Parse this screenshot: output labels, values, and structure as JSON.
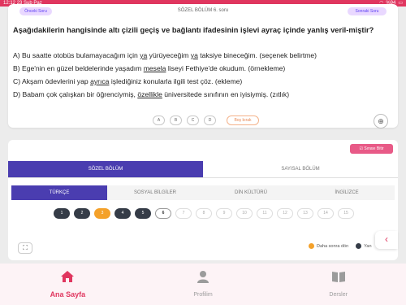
{
  "statusbar": {
    "time": "12:12",
    "date": "23 Şub Paz",
    "battery": "%94"
  },
  "question": {
    "back_label": "Önceki Soru",
    "header_title": "SÖZEL BÖLÜM 6. soru",
    "next_label": "Sonraki Soru",
    "text": "Aşağıdakilerin hangisinde altı çizili geçiş ve bağlantı ifadesinin işlevi ayraç içinde yanlış veril-miştir?",
    "options": [
      {
        "pre": "A) Bu saatte otobüs bulamayacağım için ",
        "u1": "ya",
        "mid": " yürüyeceğim ",
        "u2": "ya",
        "post": " taksiye bineceğim. (seçenek belirtme)"
      },
      {
        "pre": "B) Ege'nin en güzel beldelerinde yaşadım ",
        "u1": "mesela",
        "post": " liseyi Fethiye'de okudum. (örnekleme)"
      },
      {
        "pre": "C) Akşam ödevlerini yap ",
        "u1": "ayrıca",
        "post": " işlediğiniz konularla ilgili test çöz. (ekleme)"
      },
      {
        "pre": "D) Babam çok çalışkan bir öğrenciymiş, ",
        "u1": "özellikle",
        "post": " üniversitede sınıfının en iyisiymiş. (zıtlık)"
      }
    ],
    "answer_choices": [
      "A",
      "B",
      "C",
      "D"
    ],
    "blank_label": "Boş bırak"
  },
  "panel": {
    "exam_button": "Sınavı Bitir",
    "sections": [
      "SÖZEL BÖLÜM",
      "SAYISAL BÖLÜM"
    ],
    "subjects": [
      "TÜRKÇE",
      "SOSYAL BİLGİLER",
      "DİN KÜLTÜRÜ",
      "İNGİLİZCE"
    ],
    "numbers": [
      "1",
      "2",
      "3",
      "4",
      "5",
      "6",
      "7",
      "8",
      "9",
      "10",
      "11",
      "12",
      "13",
      "14",
      "15"
    ],
    "legend_later": "Daha sonra dön",
    "legend_answered": "Yan",
    "colors": {
      "accent": "#e0365f",
      "purple": "#4a3db0",
      "answered": "#353c47",
      "later": "#f4a12a"
    }
  },
  "nav": {
    "home": "Ana Sayfa",
    "profile": "Profilim",
    "lessons": "Dersler"
  }
}
